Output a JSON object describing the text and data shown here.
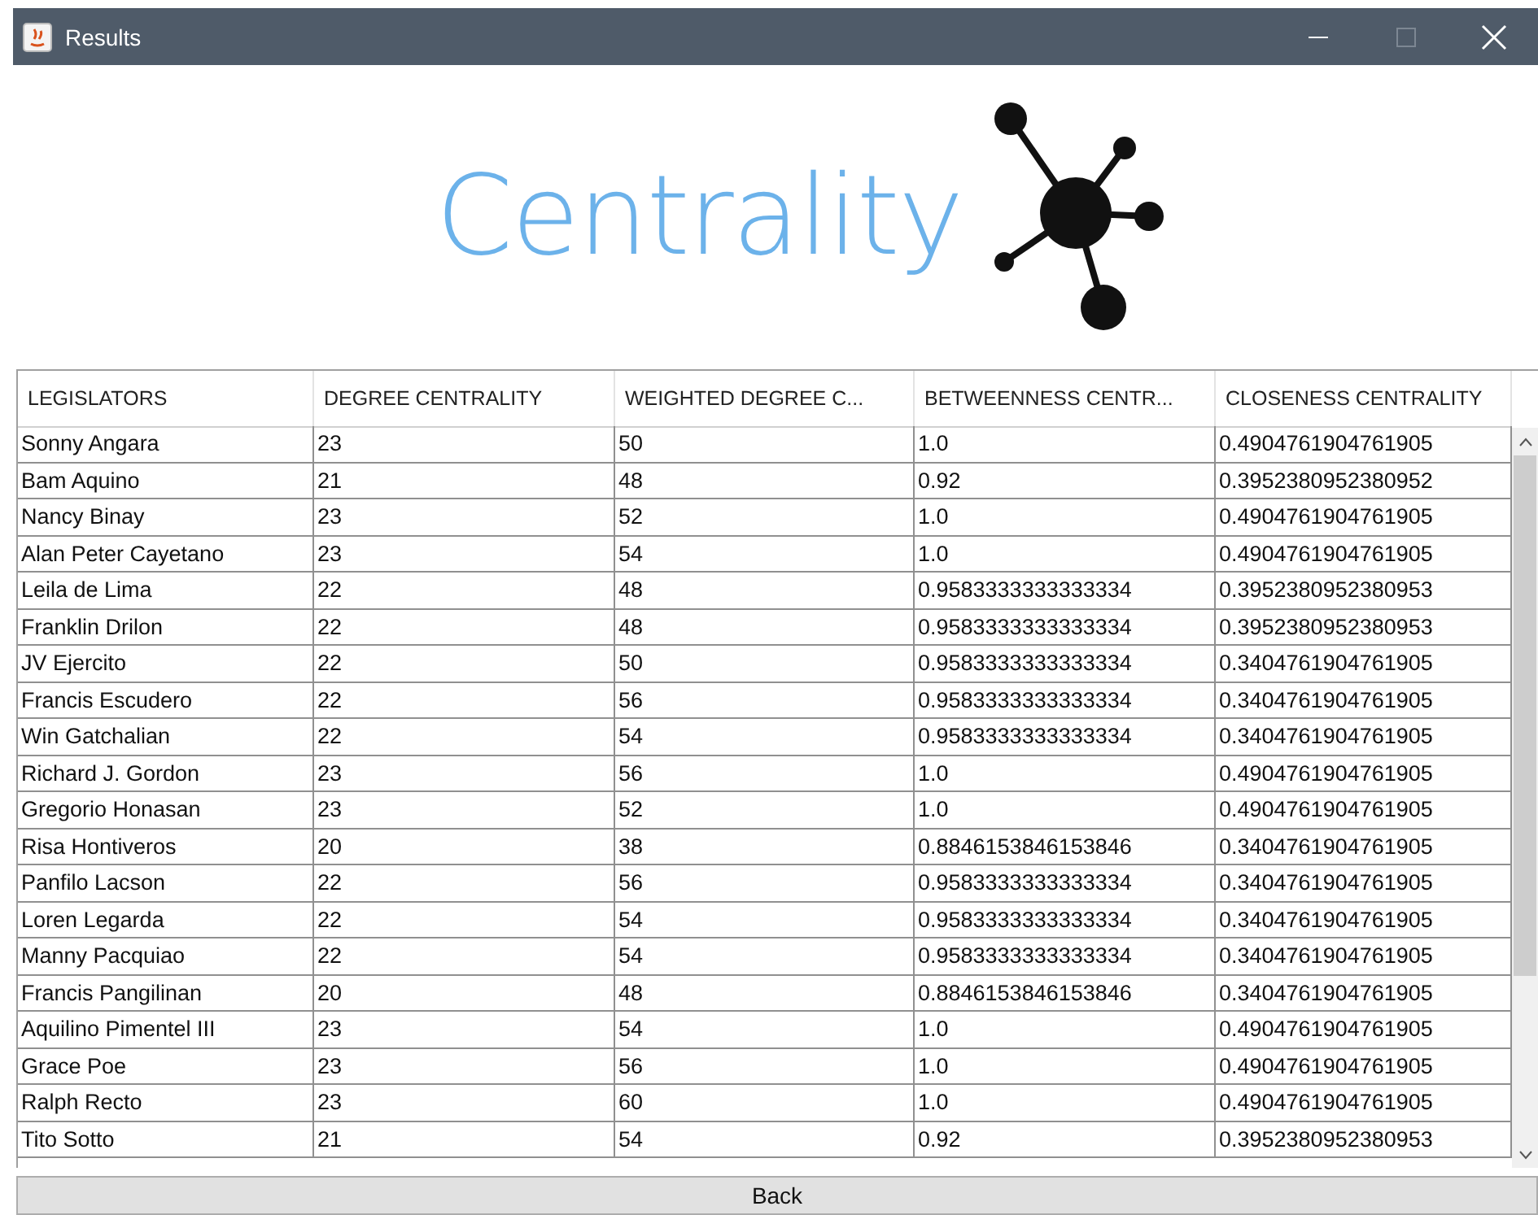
{
  "window": {
    "title": "Results"
  },
  "logo": {
    "text": "Centrality"
  },
  "table": {
    "columns": [
      "LEGISLATORS",
      "DEGREE CENTRALITY",
      "WEIGHTED DEGREE C...",
      "BETWEENNESS CENTR...",
      "CLOSENESS CENTRALITY"
    ],
    "rows": [
      [
        "Sonny Angara",
        "23",
        "50",
        "1.0",
        "0.4904761904761905"
      ],
      [
        "Bam Aquino",
        "21",
        "48",
        "0.92",
        "0.3952380952380952"
      ],
      [
        "Nancy Binay",
        "23",
        "52",
        "1.0",
        "0.4904761904761905"
      ],
      [
        "Alan Peter Cayetano",
        "23",
        "54",
        "1.0",
        "0.4904761904761905"
      ],
      [
        "Leila de Lima",
        "22",
        "48",
        "0.9583333333333334",
        "0.3952380952380953"
      ],
      [
        "Franklin Drilon",
        "22",
        "48",
        "0.9583333333333334",
        "0.3952380952380953"
      ],
      [
        "JV Ejercito",
        "22",
        "50",
        "0.9583333333333334",
        "0.3404761904761905"
      ],
      [
        "Francis Escudero",
        "22",
        "56",
        "0.9583333333333334",
        "0.3404761904761905"
      ],
      [
        "Win Gatchalian",
        "22",
        "54",
        "0.9583333333333334",
        "0.3404761904761905"
      ],
      [
        "Richard J. Gordon",
        "23",
        "56",
        "1.0",
        "0.4904761904761905"
      ],
      [
        "Gregorio Honasan",
        "23",
        "52",
        "1.0",
        "0.4904761904761905"
      ],
      [
        "Risa Hontiveros",
        "20",
        "38",
        "0.8846153846153846",
        "0.3404761904761905"
      ],
      [
        "Panfilo Lacson",
        "22",
        "56",
        "0.9583333333333334",
        "0.3404761904761905"
      ],
      [
        "Loren Legarda",
        "22",
        "54",
        "0.9583333333333334",
        "0.3404761904761905"
      ],
      [
        "Manny Pacquiao",
        "22",
        "54",
        "0.9583333333333334",
        "0.3404761904761905"
      ],
      [
        "Francis Pangilinan",
        "20",
        "48",
        "0.8846153846153846",
        "0.3404761904761905"
      ],
      [
        "Aquilino Pimentel III",
        "23",
        "54",
        "1.0",
        "0.4904761904761905"
      ],
      [
        "Grace Poe",
        "23",
        "56",
        "1.0",
        "0.4904761904761905"
      ],
      [
        "Ralph Recto",
        "23",
        "60",
        "1.0",
        "0.4904761904761905"
      ],
      [
        "Tito Sotto",
        "21",
        "54",
        "0.92",
        "0.3952380952380953"
      ]
    ]
  },
  "buttons": [
    {
      "label": "Back"
    }
  ]
}
